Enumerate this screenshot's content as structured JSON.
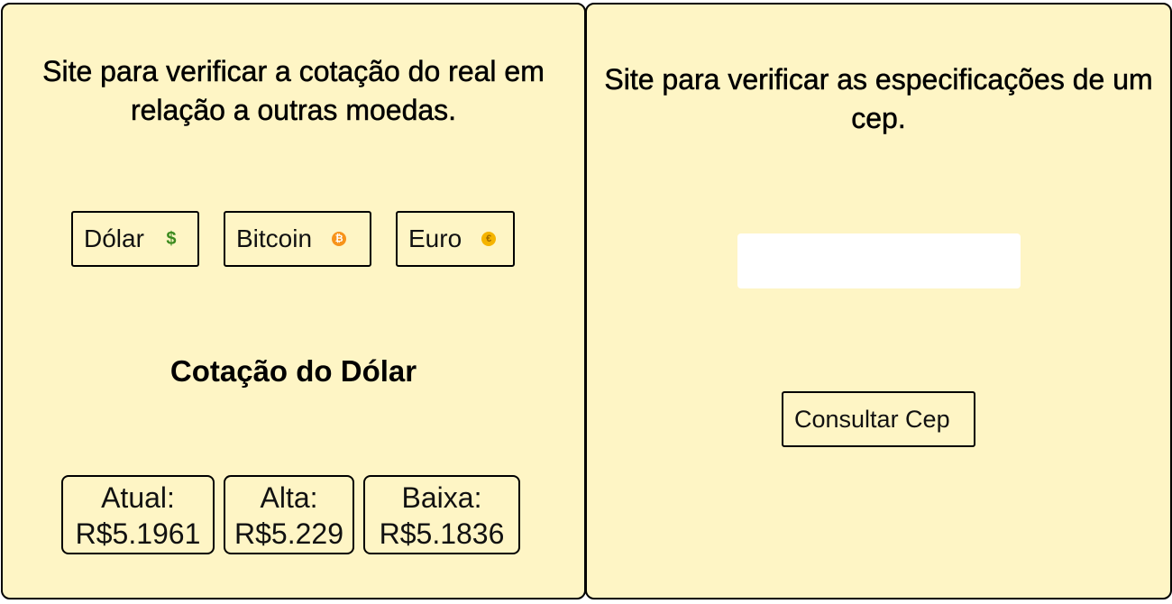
{
  "left_panel": {
    "title": "Site para verificar a cotação do real em relação a outras moedas.",
    "currencies": [
      {
        "label": "Dólar",
        "icon": "dollar-icon",
        "glyph": "$"
      },
      {
        "label": "Bitcoin",
        "icon": "bitcoin-icon",
        "glyph": "₿"
      },
      {
        "label": "Euro",
        "icon": "euro-icon",
        "glyph": "€"
      }
    ],
    "quote_title": "Cotação do Dólar",
    "quotes": [
      {
        "label": "Atual:",
        "value": "R$5.1961"
      },
      {
        "label": "Alta:",
        "value": "R$5.229"
      },
      {
        "label": "Baixa:",
        "value": "R$5.1836"
      }
    ]
  },
  "right_panel": {
    "title": "Site para verificar as especificações de um cep.",
    "cep_input": {
      "value": "",
      "placeholder": ""
    },
    "submit_label": "Consultar Cep"
  },
  "colors": {
    "panel_background": "#fef5c5",
    "border": "#000000",
    "dollar_icon": "#3b8a1e",
    "bitcoin_icon": "#f7931a",
    "euro_icon": "#f5b400"
  }
}
